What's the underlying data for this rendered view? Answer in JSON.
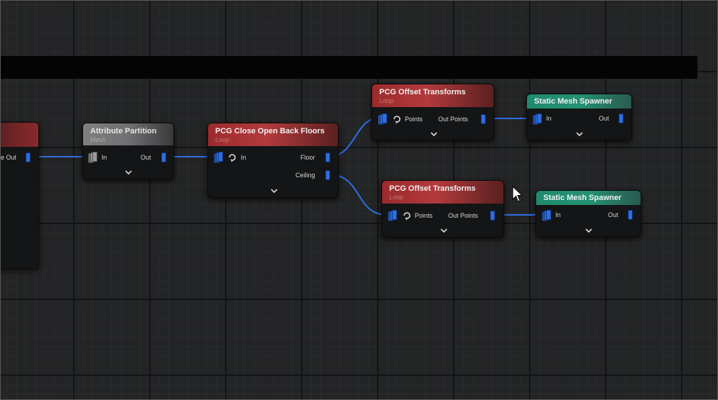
{
  "nodes": {
    "partial_node": {
      "out_label": "e Out"
    },
    "attribute_partition": {
      "title": "Attribute Partition",
      "subtitle": "Mesh",
      "in_label": "In",
      "out_label": "Out"
    },
    "close_open_back_floors": {
      "title": "PCG Close Open Back Floors",
      "subtitle": "Loop",
      "in_label": "In",
      "floor_label": "Floor",
      "ceiling_label": "Ceiling"
    },
    "offset_transforms_top": {
      "title": "PCG Offset Transforms",
      "subtitle": "Loop",
      "points_label": "Points",
      "out_label": "Out Points"
    },
    "offset_transforms_bottom": {
      "title": "PCG Offset Transforms",
      "subtitle": "Loop",
      "points_label": "Points",
      "out_label": "Out Points"
    },
    "static_mesh_spawner_top": {
      "title": "Static Mesh Spawner",
      "in_label": "In",
      "out_label": "Out"
    },
    "static_mesh_spawner_bottom": {
      "title": "Static Mesh Spawner",
      "in_label": "In",
      "out_label": "Out"
    }
  },
  "colors": {
    "wire": "#2f6fe6",
    "pin": "#2e6fe0",
    "header_red": "#a83234",
    "header_gray": "#78787a",
    "header_teal": "#229070",
    "grid_major": "#121314",
    "background": "#232425"
  },
  "icons": {
    "loop": "loop-arrow-icon",
    "expand": "chevron-down-icon",
    "cursor": "mouse-pointer-icon"
  }
}
